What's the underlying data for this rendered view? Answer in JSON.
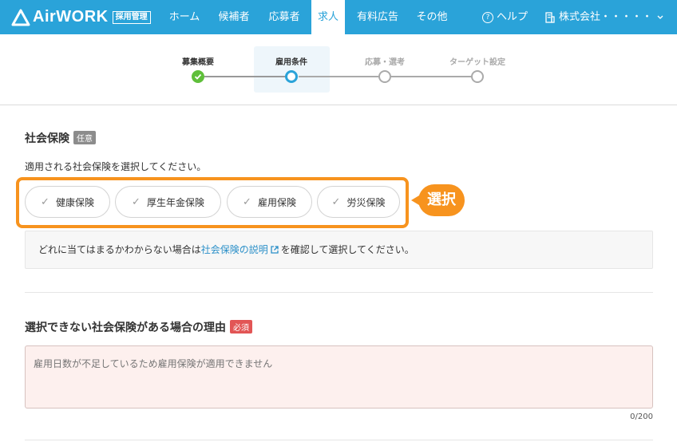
{
  "header": {
    "logo_text": "AirWORK",
    "logo_badge": "採用管理",
    "nav": [
      {
        "label": "ホーム"
      },
      {
        "label": "候補者"
      },
      {
        "label": "応募者"
      },
      {
        "label": "求人",
        "active": true
      },
      {
        "label": "有料広告"
      },
      {
        "label": "その他"
      }
    ],
    "help_label": "ヘルプ",
    "company_label": "株式会社・・・・・"
  },
  "stepper": {
    "steps": [
      {
        "label": "募集概要",
        "state": "done"
      },
      {
        "label": "雇用条件",
        "state": "current"
      },
      {
        "label": "応募・選考",
        "state": "todo"
      },
      {
        "label": "ターゲット設定",
        "state": "todo"
      }
    ]
  },
  "insurance": {
    "title": "社会保険",
    "tag": "任意",
    "description": "適用される社会保険を選択してください。",
    "options": [
      "健康保険",
      "厚生年金保険",
      "雇用保険",
      "労災保険"
    ],
    "callout": "選択",
    "info_prefix": "どれに当てはまるかわからない場合は",
    "info_link": "社会保険の説明",
    "info_suffix": "を確認して選択してください。"
  },
  "reason": {
    "title": "選択できない社会保険がある場合の理由",
    "tag": "必須",
    "placeholder": "雇用日数が不足しているため雇用保険が適用できません",
    "counter": "0/200"
  },
  "colors": {
    "brand": "#2aa3d9",
    "highlight": "#f7931e",
    "done": "#5fbf3a",
    "required": "#e25555"
  }
}
